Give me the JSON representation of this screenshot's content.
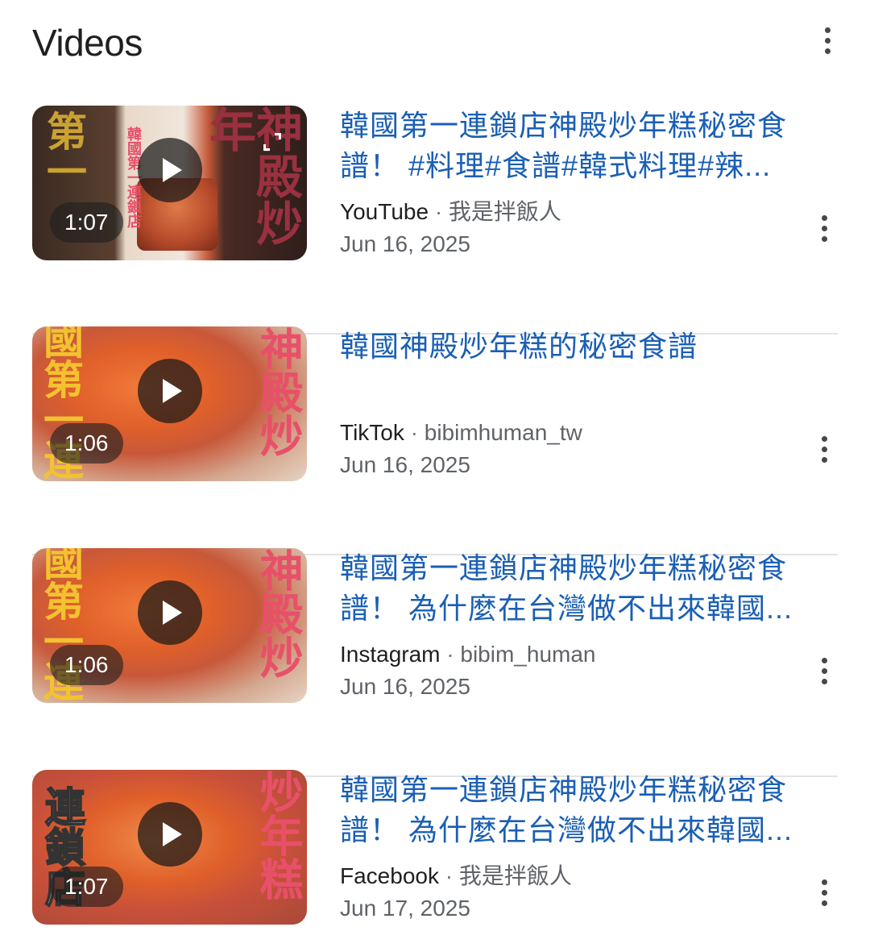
{
  "section": {
    "title": "Videos",
    "menu_icon": "more-vert-icon"
  },
  "videos": [
    {
      "title": "韓國第一連鎖店神殿炒年糕秘密食譜！ #料理#食譜#韓式料理#辣...",
      "source": "YouTube",
      "separator": "·",
      "channel": "我是拌飯人",
      "date": "Jun 16, 2025",
      "duration": "1:07",
      "thumb_left_text": "第一",
      "thumb_right_text": "神殿炒年",
      "thumb_center_text": "韓國第一連鎖店",
      "has_expand_icon": true
    },
    {
      "title": "韓國神殿炒年糕的秘密食譜",
      "source": "TikTok",
      "separator": "·",
      "channel": "bibimhuman_tw",
      "date": "Jun 16, 2025",
      "duration": "1:06",
      "thumb_left_text": "國第一連",
      "thumb_right_text": "神殿炒",
      "has_expand_icon": false
    },
    {
      "title": "韓國第一連鎖店神殿炒年糕秘密食譜！ 為什麼在台灣做不出來韓國...",
      "source": "Instagram",
      "separator": "·",
      "channel": "bibim_human",
      "date": "Jun 16, 2025",
      "duration": "1:06",
      "thumb_left_text": "國第一連",
      "thumb_right_text": "神殿炒",
      "has_expand_icon": false
    },
    {
      "title": "韓國第一連鎖店神殿炒年糕秘密食譜！ 為什麼在台灣做不出來韓國...",
      "source": "Facebook",
      "separator": "·",
      "channel": "我是拌飯人",
      "date": "Jun 17, 2025",
      "duration": "1:07",
      "thumb_left_text": "連鎖店",
      "thumb_right_text": "炒年糕",
      "has_expand_icon": false
    }
  ],
  "colors": {
    "title_link": "#1a5fb4",
    "meta_gray": "#5f6368",
    "caption_yellow": "#f2c230",
    "caption_pink": "#e8506a"
  }
}
